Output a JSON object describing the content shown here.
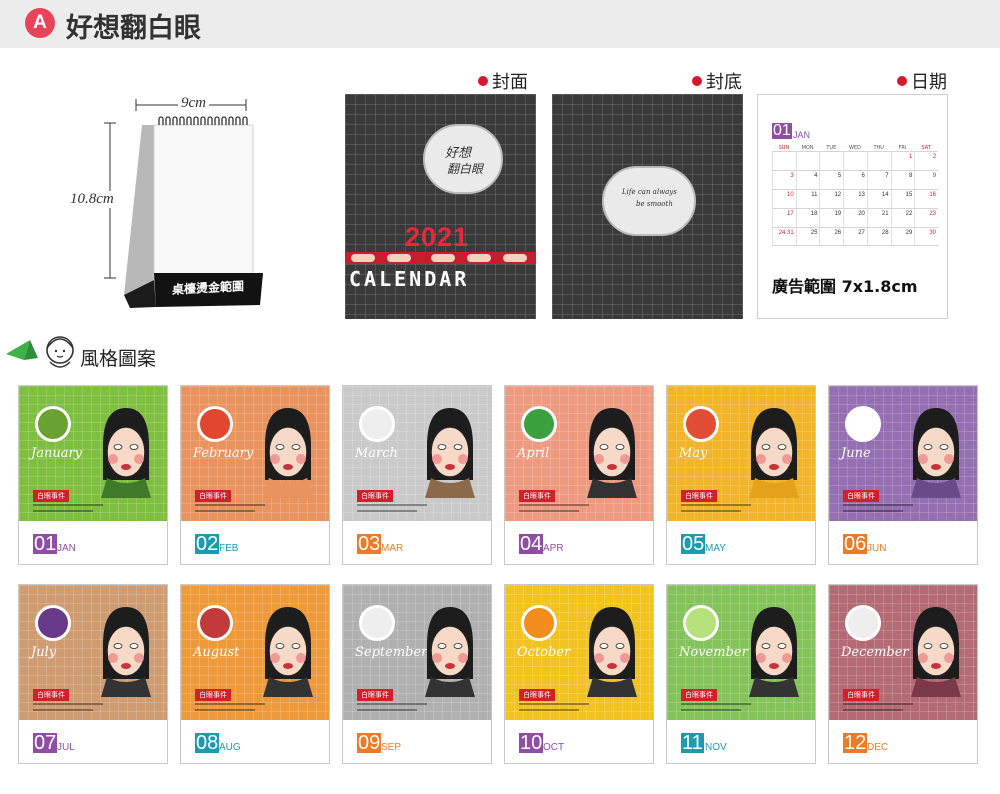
{
  "header": {
    "badge": "A",
    "title": "好想翻白眼"
  },
  "product": {
    "width_label": "9cm",
    "height_label": "10.8cm",
    "base_label": "桌檯燙金範圍"
  },
  "samples": {
    "front_label": "封面",
    "back_label": "封底",
    "date_label": "日期"
  },
  "front_cover": {
    "bubble_text_1": "好想",
    "bubble_text_2": "翻白眼",
    "year": "2021",
    "word": "CALENDAR"
  },
  "back_cover": {
    "bubble_text_1": "Life can always",
    "bubble_text_2": "be smooth"
  },
  "date_page": {
    "month_num": "01",
    "month_abbr": "JAN",
    "weekdays": [
      "SUN",
      "MON",
      "TUE",
      "WED",
      "THU",
      "FRI",
      "SAT"
    ],
    "rows": [
      [
        "",
        "",
        "",
        "",
        "",
        "1",
        "2"
      ],
      [
        "3",
        "4",
        "5",
        "6",
        "7",
        "8",
        "9"
      ],
      [
        "10",
        "11",
        "12",
        "13",
        "14",
        "15",
        "16"
      ],
      [
        "17",
        "18",
        "19",
        "20",
        "21",
        "22",
        "23"
      ],
      [
        "24 31",
        "25",
        "26",
        "27",
        "28",
        "29",
        "30"
      ]
    ],
    "ad_text": "廣告範圍 7x1.8cm"
  },
  "style_section": {
    "label": "風格圖案"
  },
  "months": [
    {
      "name": "January",
      "num": "01",
      "abbr": "JAN",
      "bg": "#7fbf3f",
      "num_bg": "#8f4ea3",
      "abbr_color": "#8f4ea3",
      "fruit": "#6aa232",
      "tag": "白眼事件",
      "shirt": "#3f7a2a"
    },
    {
      "name": "February",
      "num": "02",
      "abbr": "FEB",
      "bg": "#e9935f",
      "num_bg": "#1a9bb0",
      "abbr_color": "#1a9bb0",
      "fruit": "#e2462e",
      "tag": "白眼事件",
      "shirt": "#e9935f"
    },
    {
      "name": "March",
      "num": "03",
      "abbr": "MAR",
      "bg": "#c9c9c9",
      "num_bg": "#ee7a25",
      "abbr_color": "#ee7a25",
      "fruit": "#eeeeee",
      "tag": "白眼事件",
      "shirt": "#8b6a4a"
    },
    {
      "name": "April",
      "num": "04",
      "abbr": "APR",
      "bg": "#ee9a80",
      "num_bg": "#8f4ea3",
      "abbr_color": "#8f4ea3",
      "fruit": "#3aa040",
      "tag": "白眼事件",
      "shirt": "#333333"
    },
    {
      "name": "May",
      "num": "05",
      "abbr": "MAY",
      "bg": "#f2b52a",
      "num_bg": "#1a9bb0",
      "abbr_color": "#1a9bb0",
      "fruit": "#e24d35",
      "tag": "白眼事件",
      "shirt": "#e3a21a"
    },
    {
      "name": "June",
      "num": "06",
      "abbr": "JUN",
      "bg": "#9470b2",
      "num_bg": "#ee7a25",
      "abbr_color": "#ee7a25",
      "fruit": "#ffffff",
      "tag": "白眼事件",
      "shirt": "#6b4a8a"
    },
    {
      "name": "July",
      "num": "07",
      "abbr": "JUL",
      "bg": "#cf9c72",
      "num_bg": "#8f4ea3",
      "abbr_color": "#8f4ea3",
      "fruit": "#6a3a8a",
      "tag": "白眼事件",
      "shirt": "#333333"
    },
    {
      "name": "August",
      "num": "08",
      "abbr": "AUG",
      "bg": "#ee9a3a",
      "num_bg": "#1a9bb0",
      "abbr_color": "#1a9bb0",
      "fruit": "#c23a3a",
      "tag": "白眼事件",
      "shirt": "#333333"
    },
    {
      "name": "September",
      "num": "09",
      "abbr": "SEP",
      "bg": "#b0b0b0",
      "num_bg": "#ee7a25",
      "abbr_color": "#ee7a25",
      "fruit": "#eeeeee",
      "tag": "白眼事件",
      "shirt": "#333333"
    },
    {
      "name": "October",
      "num": "10",
      "abbr": "OCT",
      "bg": "#f2c320",
      "num_bg": "#8f4ea3",
      "abbr_color": "#8f4ea3",
      "fruit": "#f28c1a",
      "tag": "白眼事件",
      "shirt": "#333333"
    },
    {
      "name": "November",
      "num": "11",
      "abbr": "NOV",
      "bg": "#84c25a",
      "num_bg": "#1a9bb0",
      "abbr_color": "#1a9bb0",
      "fruit": "#b6e07a",
      "tag": "白眼事件",
      "shirt": "#333333"
    },
    {
      "name": "December",
      "num": "12",
      "abbr": "DEC",
      "bg": "#b46a75",
      "num_bg": "#ee7a25",
      "abbr_color": "#ee7a25",
      "fruit": "#eeeeee",
      "tag": "白眼事件",
      "shirt": "#7a3a4a"
    }
  ]
}
